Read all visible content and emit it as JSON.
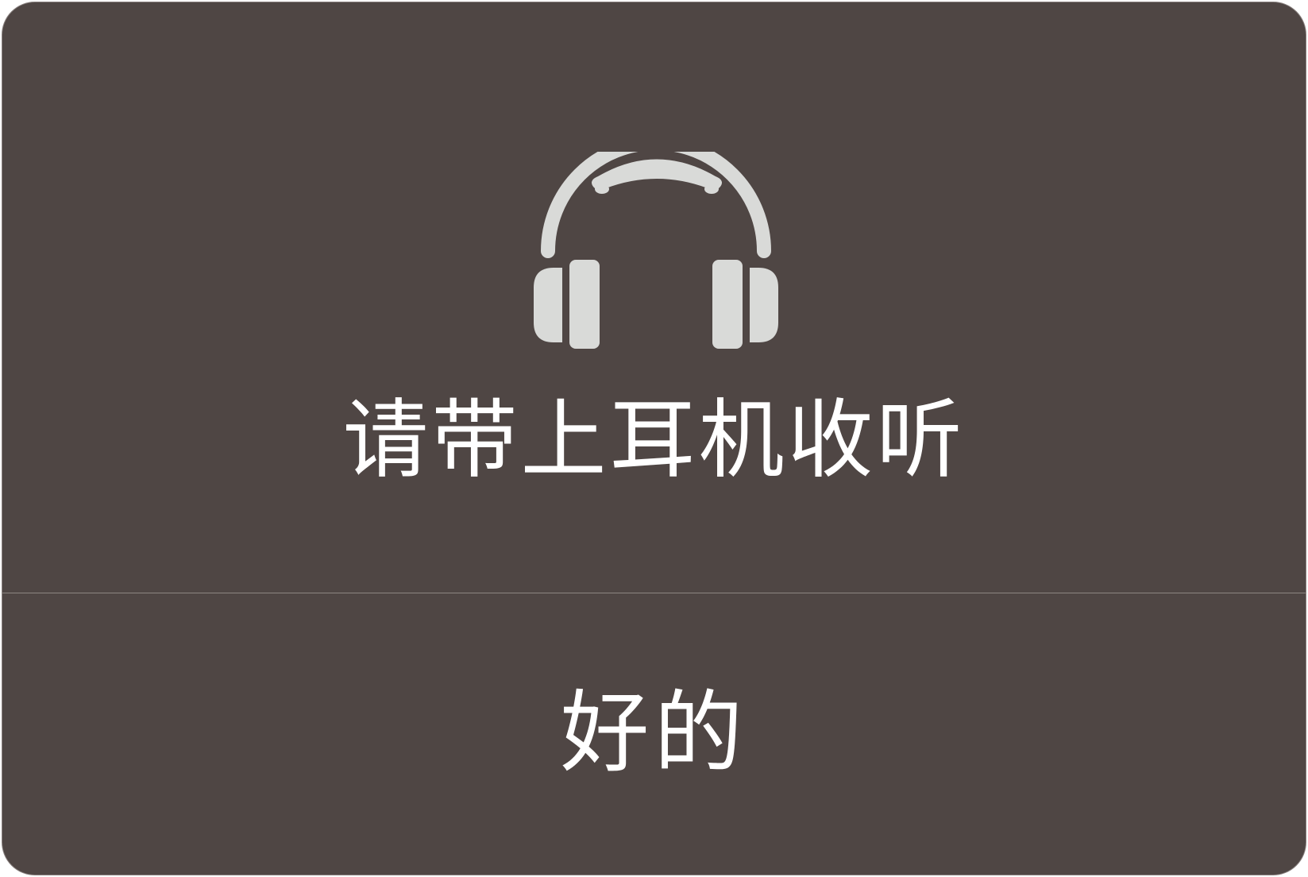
{
  "dialog": {
    "icon": "headphones-icon",
    "message": "请带上耳机收听",
    "confirm_label": "好的"
  },
  "colors": {
    "background": "#4f4644",
    "icon": "#d9dad8",
    "text": "#ffffff",
    "divider": "#8e8683"
  }
}
